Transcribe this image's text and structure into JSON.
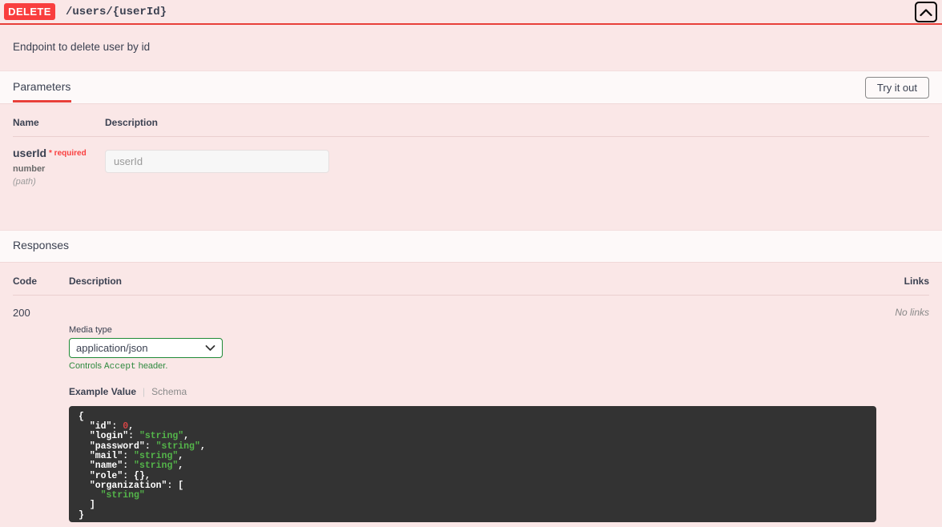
{
  "operation": {
    "method": "DELETE",
    "path": "/users/{userId}",
    "description": "Endpoint to delete user by id",
    "collapse_icon": "chevron-up-icon"
  },
  "parameters_section": {
    "title": "Parameters",
    "try_it_out_label": "Try it out",
    "columns": {
      "name": "Name",
      "description": "Description"
    },
    "rows": [
      {
        "name": "userId",
        "required_label": "* required",
        "type": "number",
        "in": "(path)",
        "input_value": "",
        "input_placeholder": "userId"
      }
    ]
  },
  "responses_section": {
    "title": "Responses",
    "columns": {
      "code": "Code",
      "description": "Description",
      "links": "Links"
    },
    "rows": [
      {
        "code": "200",
        "links": "No links",
        "media_type_label": "Media type",
        "media_type_value": "application/json",
        "media_type_chevron": "chevron-down-icon",
        "media_hint_prefix": "Controls ",
        "media_hint_code": "Accept",
        "media_hint_suffix": " header.",
        "example_tab_active": "Example Value",
        "example_tab_divider": "|",
        "example_tab_inactive": "Schema",
        "example_json": {
          "id": 0,
          "login": "string",
          "password": "string",
          "mail": "string",
          "name": "string",
          "role": {},
          "organization": [
            "string"
          ]
        }
      }
    ]
  },
  "colors": {
    "method_badge": "#f93e3e",
    "background": "#fae7e7",
    "strip": "#fdf9f9",
    "accent_red": "#e8403a",
    "select_border_green": "#1f8a36",
    "hint_green": "#2f8a3f",
    "code_background": "#333333",
    "code_string": "#54b54a",
    "code_number": "#d64545"
  }
}
